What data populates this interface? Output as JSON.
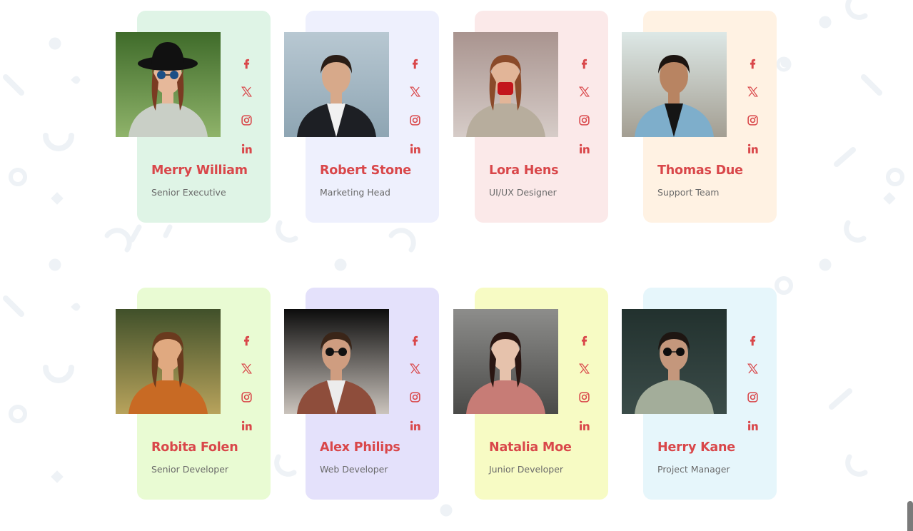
{
  "theme": {
    "accent": "#d9474a",
    "role_color": "#6a6a6a",
    "background": "#ffffff"
  },
  "team": [
    {
      "name": "Merry William",
      "role": "Senior Executive",
      "card_color": "#dff4e6",
      "photo": "woman-hat-sunglasses-portrait",
      "socials": [
        "facebook-icon",
        "x-twitter-icon",
        "instagram-icon",
        "linkedin-icon"
      ]
    },
    {
      "name": "Robert Stone",
      "role": "Marketing Head",
      "card_color": "#eef0fd",
      "photo": "man-suit-portrait",
      "socials": [
        "facebook-icon",
        "x-twitter-icon",
        "instagram-icon",
        "linkedin-icon"
      ]
    },
    {
      "name": "Lora Hens",
      "role": "UI/UX Designer",
      "card_color": "#fbe9e9",
      "photo": "woman-red-mug-portrait",
      "socials": [
        "facebook-icon",
        "x-twitter-icon",
        "instagram-icon",
        "linkedin-icon"
      ]
    },
    {
      "name": "Thomas Due",
      "role": "Support Team",
      "card_color": "#fff2e3",
      "photo": "man-denim-jacket-portrait",
      "socials": [
        "facebook-icon",
        "x-twitter-icon",
        "instagram-icon",
        "linkedin-icon"
      ]
    },
    {
      "name": "Robita Folen",
      "role": "Senior Developer",
      "card_color": "#e9fbd3",
      "photo": "woman-glasses-orange-sweater-portrait",
      "socials": [
        "facebook-icon",
        "x-twitter-icon",
        "instagram-icon",
        "linkedin-icon"
      ]
    },
    {
      "name": "Alex Philips",
      "role": "Web Developer",
      "card_color": "#e4e1fb",
      "photo": "man-sunglasses-brown-jacket-portrait",
      "socials": [
        "facebook-icon",
        "x-twitter-icon",
        "instagram-icon",
        "linkedin-icon"
      ]
    },
    {
      "name": "Natalia Moe",
      "role": "Junior Developer",
      "card_color": "#f7fbc4",
      "photo": "woman-pink-sweater-portrait",
      "socials": [
        "facebook-icon",
        "x-twitter-icon",
        "instagram-icon",
        "linkedin-icon"
      ]
    },
    {
      "name": "Herry Kane",
      "role": "Project Manager",
      "card_color": "#e6f6fb",
      "photo": "man-trench-coat-portrait",
      "socials": [
        "facebook-icon",
        "x-twitter-icon",
        "instagram-icon",
        "linkedin-icon"
      ]
    }
  ]
}
